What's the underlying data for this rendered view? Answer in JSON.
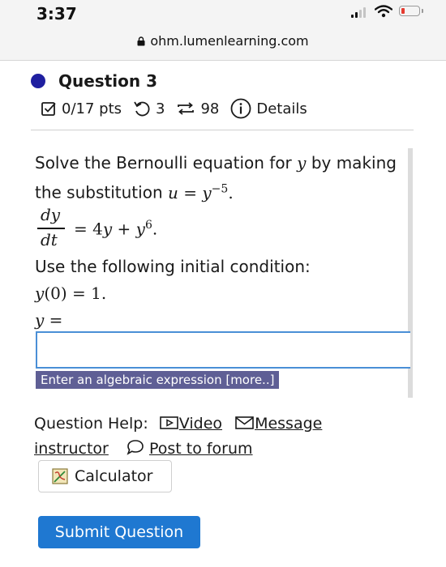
{
  "status_bar": {
    "time": "3:37"
  },
  "browser": {
    "url": "ohm.lumenlearning.com"
  },
  "question": {
    "title": "Question 3",
    "points": "0/17 pts",
    "attempts": "3",
    "submissions": "98",
    "details_label": "Details",
    "prompt_line1": "Solve the Bernoulli equation for",
    "prompt_var": "y",
    "prompt_line1_end": "by making",
    "prompt_line2": "the substitution",
    "substitution": {
      "lhs": "u",
      "equals": "=",
      "base": "y",
      "exponent": "−5",
      "end": "."
    },
    "equation": {
      "numerator": "dy",
      "denominator": "dt",
      "rhs_prefix": "= 4",
      "rhs_var1": "y",
      "rhs_mid": " + ",
      "rhs_var2": "y",
      "rhs_exponent": "6",
      "rhs_end": "."
    },
    "initial_condition_label": "Use the following initial condition:",
    "initial_condition": {
      "var": "y",
      "rest": "(0) = 1."
    },
    "answer_label": {
      "var": "y",
      "rest": " ="
    },
    "answer_value": "",
    "answer_hint": "Enter an algebraic expression [more..]"
  },
  "help": {
    "label": "Question Help:",
    "video": "Video",
    "message": "Message",
    "instructor": "instructor",
    "forum": "Post to forum"
  },
  "buttons": {
    "calculator": "Calculator",
    "submit": "Submit Question"
  },
  "colors": {
    "accent": "#1f78d1",
    "question_dot": "#1f1fa0",
    "hint_bg": "#5f5f95"
  }
}
